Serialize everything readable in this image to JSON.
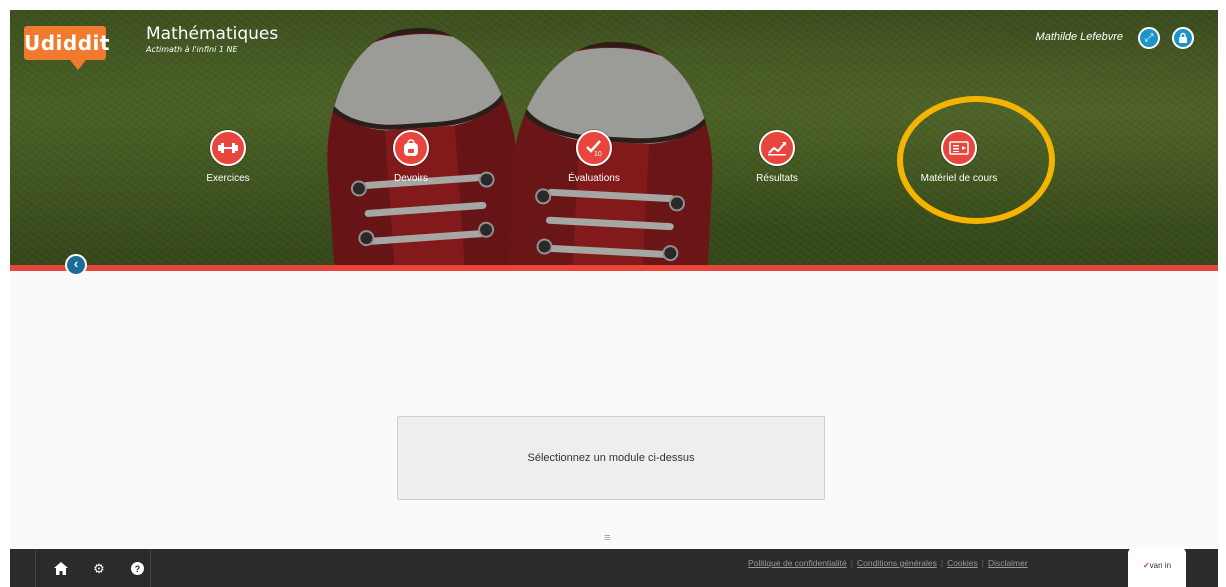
{
  "header": {
    "logo_text": "Udiddit",
    "title": "Mathématiques",
    "subtitle": "Actimath à l'infini 1 NE",
    "user_name": "Mathilde Lefebvre"
  },
  "modules": [
    {
      "label": "Exercices",
      "icon": "dumbbell-icon"
    },
    {
      "label": "Devoirs",
      "icon": "backpack-icon"
    },
    {
      "label": "Évaluations",
      "icon": "grade-icon"
    },
    {
      "label": "Résultats",
      "icon": "chart-icon"
    },
    {
      "label": "Matériel de cours",
      "icon": "course-material-icon"
    }
  ],
  "main": {
    "prompt": "Sélectionnez un module ci-dessus"
  },
  "footer": {
    "links": [
      "Politique de confidentialité",
      "Conditions générales",
      "Cookies",
      "Disclaimer"
    ],
    "brand": "van in"
  },
  "colors": {
    "accent_red": "#e8453c",
    "brand_orange": "#f07a2e",
    "button_blue": "#1c93c9",
    "highlight": "#f5b400"
  }
}
